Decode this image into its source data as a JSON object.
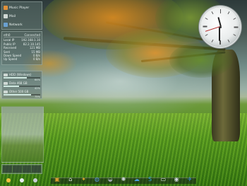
{
  "menu": {
    "items": [
      {
        "label": "Music Player",
        "color": "#e0903a"
      },
      {
        "label": "Mail",
        "color": "#d0d8d4"
      },
      {
        "label": "Network",
        "color": "#6aa0d0"
      }
    ]
  },
  "network": {
    "header_left": "eth0",
    "header_right": "Connected",
    "rows": [
      {
        "label": "Local IP",
        "value": "192.168.1.10"
      },
      {
        "label": "Public IP",
        "value": "82.2.10.145"
      },
      {
        "label": "Received",
        "value": "121 MB"
      },
      {
        "label": "Sent",
        "value": "15 MB"
      },
      {
        "label": "Down Speed",
        "value": "0 B/s"
      },
      {
        "label": "Up Speed",
        "value": "0 B/s"
      }
    ]
  },
  "disks": [
    {
      "label": "HDD (Windows)",
      "value": "64%",
      "fill": 0.64
    },
    {
      "label": "Data  468 GB",
      "value": "42%",
      "fill": 0.42
    },
    {
      "label": "Other  500 GB",
      "value": "75%",
      "fill": 0.75
    }
  ],
  "clock": {
    "hour": 11,
    "minute": 30,
    "second": 42
  },
  "dock": {
    "icons": [
      {
        "name": "folder-icon",
        "glyph": "▣",
        "color": "#d8a030"
      },
      {
        "name": "home-icon",
        "glyph": "⌂",
        "color": "#e8eeee"
      },
      {
        "name": "explorer-icon",
        "glyph": "✦",
        "color": "#d9a52a"
      },
      {
        "name": "globe-icon",
        "glyph": "◍",
        "color": "#5a92d8"
      },
      {
        "name": "gamepad-icon",
        "glyph": "◒",
        "color": "#9aa4a8"
      },
      {
        "name": "settings-icon",
        "glyph": "✺",
        "color": "#cfd6d8"
      },
      {
        "name": "chat-icon",
        "glyph": "☁",
        "color": "#4aa0e0"
      },
      {
        "name": "skype-icon",
        "glyph": "S",
        "color": "#2a9ee0"
      },
      {
        "name": "monitor-icon",
        "glyph": "▭",
        "color": "#e6ecee"
      },
      {
        "name": "camera-icon",
        "glyph": "◉",
        "color": "#d0d8dc"
      },
      {
        "name": "bird-icon",
        "glyph": "✈",
        "color": "#3a8ad8"
      }
    ]
  }
}
